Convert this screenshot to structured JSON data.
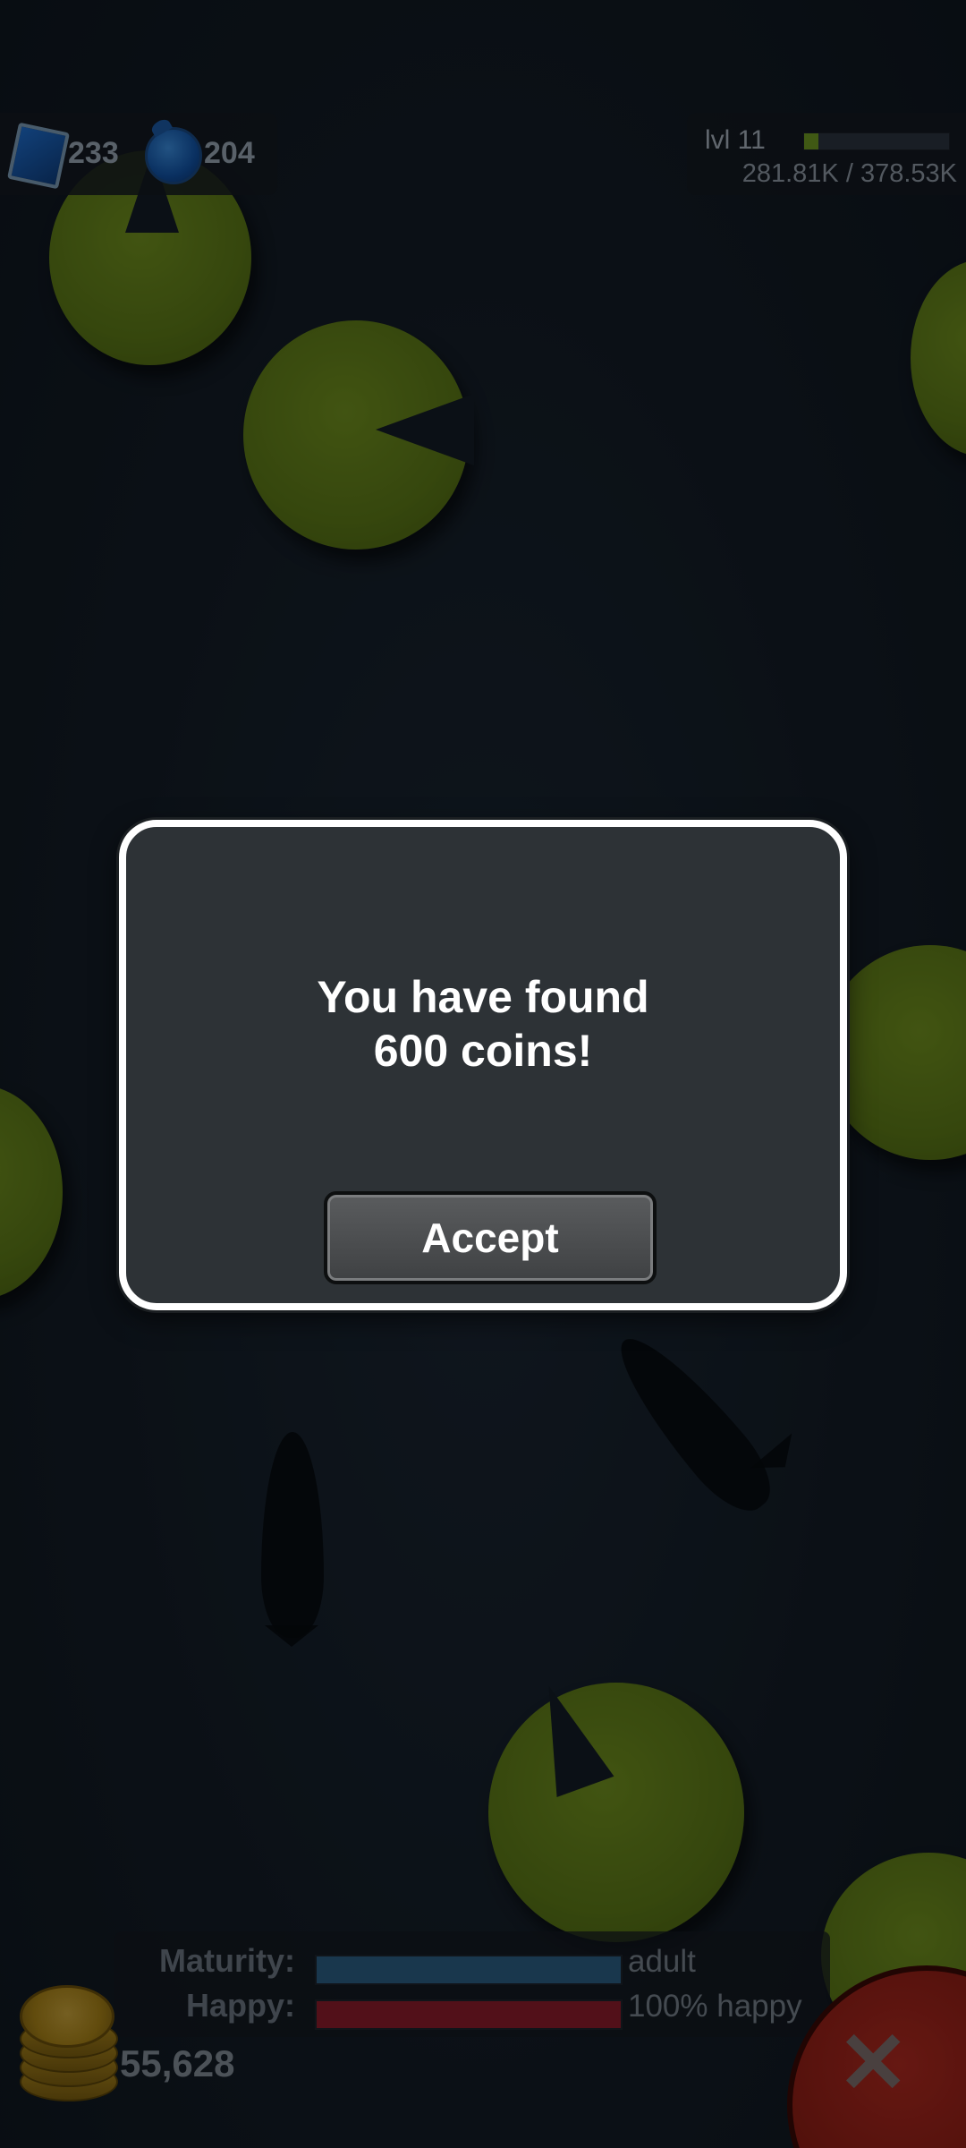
{
  "currency": {
    "gems": "233",
    "pearls": "204",
    "gem_icon": "blue-gem-icon",
    "pearl_icon": "blue-pearl-icon"
  },
  "level": {
    "label": "lvl 11",
    "xp_text": "281.81K / 378.53K",
    "xp_progress": 0.1
  },
  "dialog": {
    "line1": "You have found",
    "line2": "600 coins!",
    "accept_label": "Accept"
  },
  "stats": {
    "maturity_label": "Maturity:",
    "maturity_value": "adult",
    "maturity_progress": 1.0,
    "maturity_color": "#2b5f86",
    "happy_label": "Happy:",
    "happy_value": "100% happy",
    "happy_progress": 1.0,
    "happy_color": "#8e1c2c"
  },
  "coins": {
    "count": "55,628",
    "icon": "coin-stack-icon"
  },
  "close": {
    "icon": "close-icon",
    "glyph": "✕"
  }
}
